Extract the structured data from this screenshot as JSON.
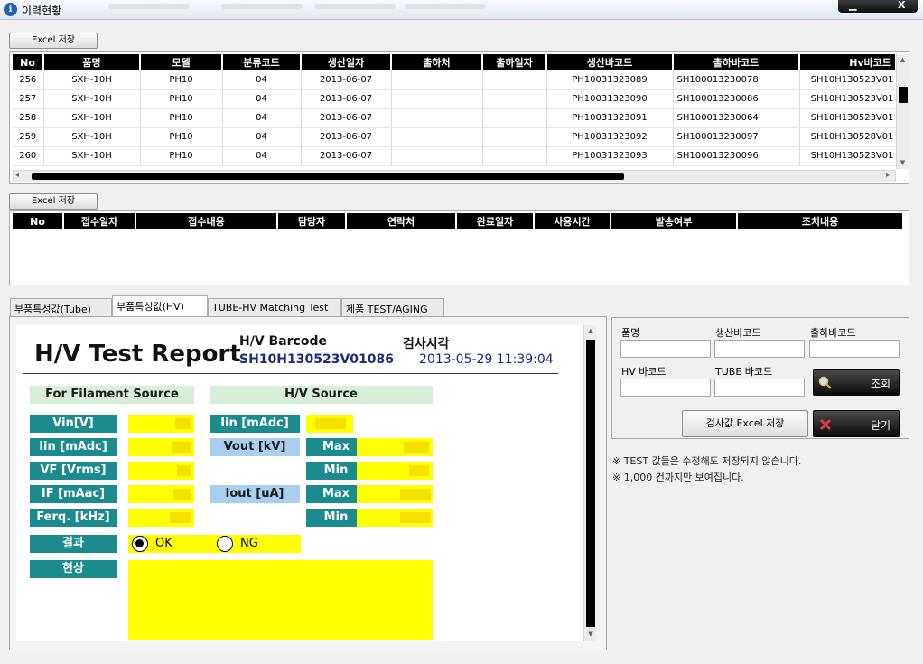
{
  "window": {
    "title": "이력현황",
    "minimize_glyph": "▁",
    "close_glyph": "X"
  },
  "excel_button_label": "Excel 저장",
  "upper_table": {
    "headers": [
      "No",
      "품명",
      "모델",
      "분류코드",
      "생산일자",
      "출하처",
      "출하일자",
      "생산바코드",
      "출하바코드",
      "Hv바코드"
    ],
    "rows": [
      [
        "256",
        "SXH-10H",
        "PH10",
        "04",
        "2013-06-07",
        "",
        "",
        "PH10031323089",
        "SH100013230078",
        "SH10H130523V01"
      ],
      [
        "257",
        "SXH-10H",
        "PH10",
        "04",
        "2013-06-07",
        "",
        "",
        "PH10031323090",
        "SH100013230086",
        "SH10H130523V01"
      ],
      [
        "258",
        "SXH-10H",
        "PH10",
        "04",
        "2013-06-07",
        "",
        "",
        "PH10031323091",
        "SH100013230064",
        "SH10H130523V01"
      ],
      [
        "259",
        "SXH-10H",
        "PH10",
        "04",
        "2013-06-07",
        "",
        "",
        "PH10031323092",
        "SH100013230097",
        "SH10H130528V01"
      ],
      [
        "260",
        "SXH-10H",
        "PH10",
        "04",
        "2013-06-07",
        "",
        "",
        "PH10031323093",
        "SH100013230096",
        "SH10H130523V01"
      ]
    ]
  },
  "lower_table": {
    "headers": [
      "No",
      "접수일자",
      "접수내용",
      "담당자",
      "연락처",
      "완료일자",
      "사용시간",
      "발송여부",
      "조치내용"
    ]
  },
  "tabs": [
    "부품특성값(Tube)",
    "부품특성값(HV)",
    "TUBE-HV Matching Test",
    "제품 TEST/AGING"
  ],
  "report": {
    "title": "H/V Test Report",
    "barcode_label": "H/V Barcode",
    "barcode_value": "SH10H130523V01086",
    "time_label": "검사시각",
    "time_value": "2013-05-29 11:39:04",
    "filament_section": "For Filament Source",
    "hv_section": "H/V Source",
    "vin": "Vin[V]",
    "iin_madc": "Iin [mAdc]",
    "vf": "VF [Vrms]",
    "if_maac": "IF [mAac]",
    "freq": "Ferq. [kHz]",
    "hv_iin": "Iin [mAdc]",
    "vout": "Vout [kV]",
    "iout": "Iout [uA]",
    "max": "Max",
    "min": "Min",
    "result": "결과",
    "ok": "OK",
    "ng": "NG",
    "phenomenon": "현상"
  },
  "search": {
    "product_label": "품명",
    "prod_barcode_label": "생산바코드",
    "ship_barcode_label": "출하바코드",
    "hv_barcode_label": "HV 바코드",
    "tube_barcode_label": "TUBE 바코드",
    "search_button": "조회",
    "excel_button": "검사값 Excel 저장",
    "close_button": "닫기"
  },
  "notes": [
    "※ TEST 값들은 수정해도 저장되지 않습니다.",
    "※ 1,000 건까지만 보여집니다."
  ]
}
